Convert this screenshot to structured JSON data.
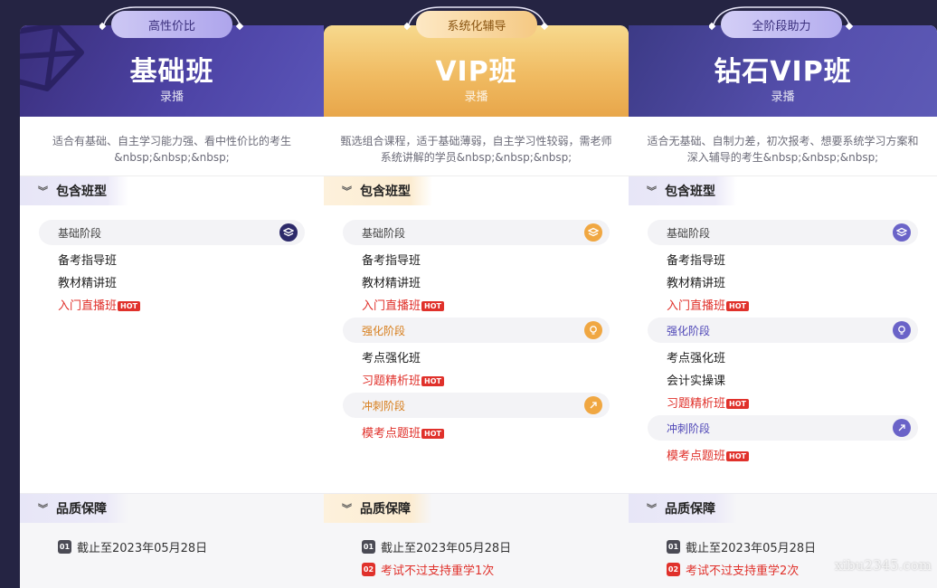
{
  "plans": [
    {
      "tag": "高性价比",
      "title": "基础班",
      "subtitle": "录播",
      "description": "适合有基础、自主学习能力强、看中性价比的考生&nbsp;&nbsp;&nbsp;",
      "classes_heading": "包含班型",
      "stages": [
        {
          "name": "基础阶段",
          "icon": "layers-icon",
          "items": [
            {
              "label": "备考指导班",
              "hot": false
            },
            {
              "label": "教材精讲班",
              "hot": false
            },
            {
              "label": "入门直播班",
              "hot": true
            }
          ]
        }
      ],
      "quality_heading": "品质保障",
      "guarantees": [
        {
          "num": "01",
          "text": "截止至2023年05月28日"
        }
      ]
    },
    {
      "tag": "系统化辅导",
      "title": "VIP班",
      "subtitle": "录播",
      "description": "甄选组合课程，适于基础薄弱，自主学习性较弱，需老师系统讲解的学员&nbsp;&nbsp;&nbsp;",
      "classes_heading": "包含班型",
      "stages": [
        {
          "name": "基础阶段",
          "icon": "layers-icon",
          "items": [
            {
              "label": "备考指导班",
              "hot": false
            },
            {
              "label": "教材精讲班",
              "hot": false
            },
            {
              "label": "入门直播班",
              "hot": true
            }
          ]
        },
        {
          "name": "强化阶段",
          "icon": "lightbulb-icon",
          "items": [
            {
              "label": "考点强化班",
              "hot": false
            },
            {
              "label": "习题精析班",
              "hot": true
            }
          ]
        },
        {
          "name": "冲刺阶段",
          "icon": "rocket-icon",
          "items": [
            {
              "label": "模考点题班",
              "hot": true
            }
          ]
        }
      ],
      "quality_heading": "品质保障",
      "guarantees": [
        {
          "num": "01",
          "text": "截止至2023年05月28日"
        },
        {
          "num": "02",
          "text": "考试不过支持重学1次"
        }
      ]
    },
    {
      "tag": "全阶段助力",
      "title": "钻石VIP班",
      "subtitle": "录播",
      "description": "适合无基础、自制力差，初次报考、想要系统学习方案和深入辅导的考生&nbsp;&nbsp;&nbsp;",
      "classes_heading": "包含班型",
      "stages": [
        {
          "name": "基础阶段",
          "icon": "layers-icon",
          "items": [
            {
              "label": "备考指导班",
              "hot": false
            },
            {
              "label": "教材精讲班",
              "hot": false
            },
            {
              "label": "入门直播班",
              "hot": true
            }
          ]
        },
        {
          "name": "强化阶段",
          "icon": "lightbulb-icon",
          "items": [
            {
              "label": "考点强化班",
              "hot": false
            },
            {
              "label": "会计实操课",
              "hot": false
            },
            {
              "label": "习题精析班",
              "hot": true
            }
          ]
        },
        {
          "name": "冲刺阶段",
          "icon": "rocket-icon",
          "items": [
            {
              "label": "模考点题班",
              "hot": true
            }
          ]
        }
      ],
      "quality_heading": "品质保障",
      "guarantees": [
        {
          "num": "01",
          "text": "截止至2023年05月28日"
        },
        {
          "num": "02",
          "text": "考试不过支持重学2次"
        }
      ]
    }
  ],
  "hot_label": "HOT",
  "watermark": "xibu2345.com",
  "colors": {
    "page_bg": "#252443",
    "purple_accent": "#4f47b7",
    "gold_accent": "#f0a742",
    "hot_red": "#e0312b"
  }
}
